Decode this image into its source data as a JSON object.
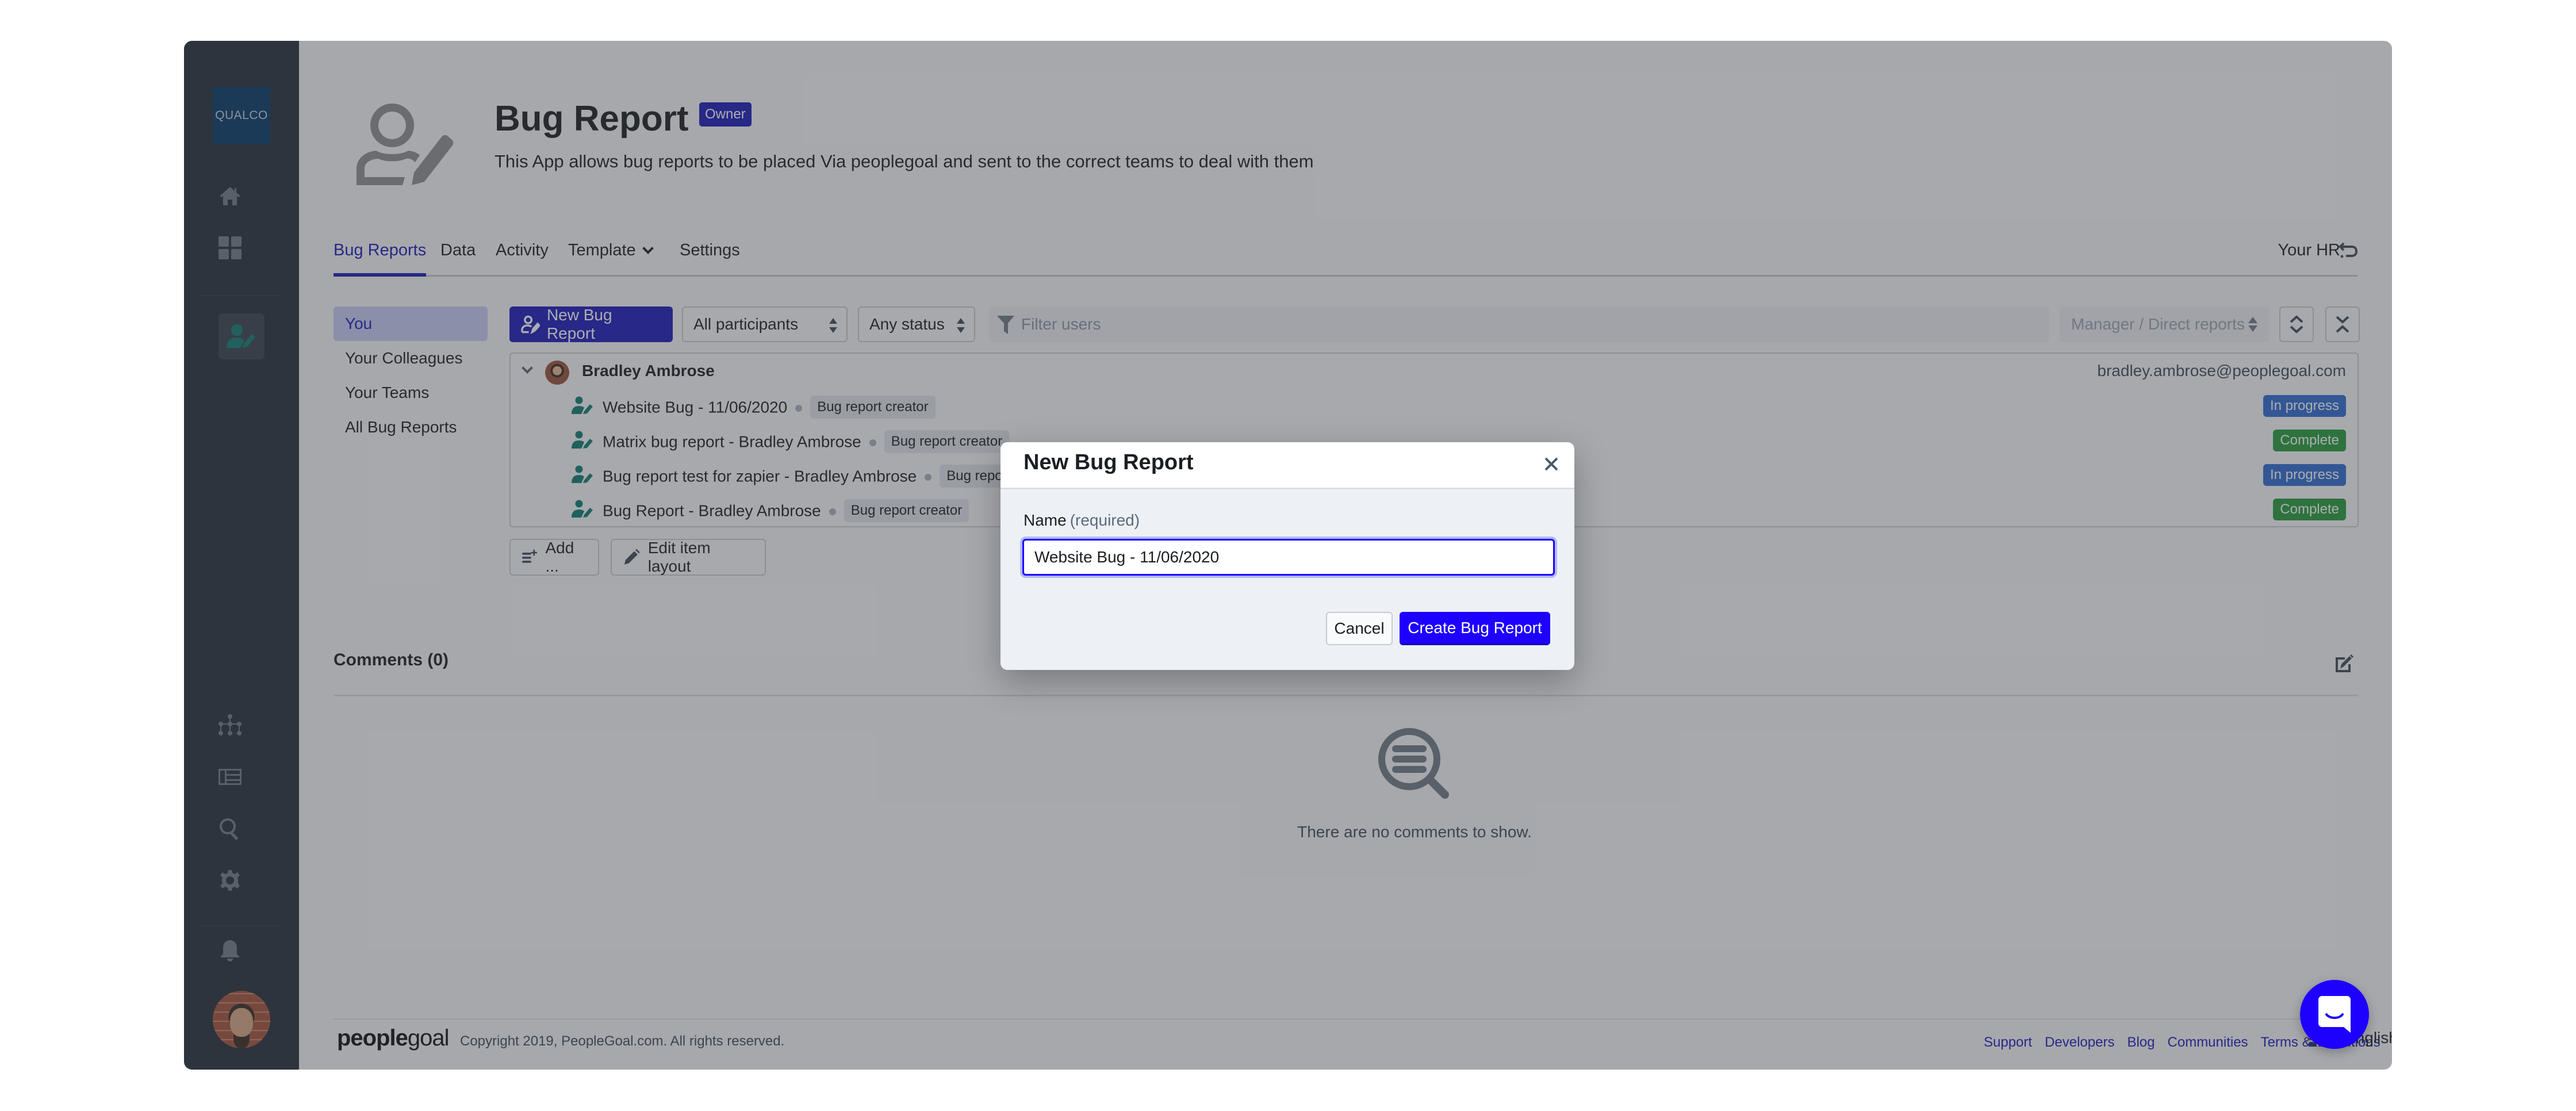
{
  "sidebar": {
    "logo_text": "QUALCO",
    "icons": [
      "home-icon",
      "apps-grid-icon",
      "bug-report-app-icon",
      "org-chart-icon",
      "table-icon",
      "search-icon",
      "settings-icon",
      "notifications-icon",
      "user-avatar"
    ]
  },
  "header": {
    "title": "Bug Report",
    "badge": "Owner",
    "subtitle": "This App allows bug reports to be placed Via peoplegoal and sent to the correct teams to deal with them"
  },
  "tabs": [
    {
      "label": "Bug Reports",
      "active": true
    },
    {
      "label": "Data",
      "active": false
    },
    {
      "label": "Activity",
      "active": false
    },
    {
      "label": "Template",
      "active": false,
      "has_dropdown": true
    },
    {
      "label": "Settings",
      "active": false
    }
  ],
  "your_hr": {
    "label": "Your HR"
  },
  "left_nav": [
    {
      "label": "You",
      "active": true
    },
    {
      "label": "Your Colleagues",
      "active": false
    },
    {
      "label": "Your Teams",
      "active": false
    },
    {
      "label": "All Bug Reports",
      "active": false
    }
  ],
  "toolbar": {
    "new_button": "New Bug Report",
    "participants_select": "All participants",
    "status_select": "Any status",
    "filter_placeholder": "Filter users",
    "manager_select": "Manager / Direct reports"
  },
  "group": {
    "name": "Bradley Ambrose",
    "email": "bradley.ambrose@peoplegoal.com",
    "items": [
      {
        "title": "Website Bug - 11/06/2020",
        "role": "Bug report creator",
        "status": "In progress"
      },
      {
        "title": "Matrix bug report - Bradley Ambrose",
        "role": "Bug report creator",
        "status": "Complete"
      },
      {
        "title": "Bug report test for zapier - Bradley Ambrose",
        "role": "Bug report creator",
        "status": "In progress"
      },
      {
        "title": "Bug Report - Bradley Ambrose",
        "role": "Bug report creator",
        "status": "Complete"
      }
    ]
  },
  "actions": {
    "add": "Add ...",
    "edit_layout": "Edit item layout"
  },
  "comments": {
    "title": "Comments (0)",
    "empty_text": "There are no comments to show."
  },
  "footer": {
    "logo_bold": "people",
    "logo_light": "goal",
    "copyright": "Copyright 2019, PeopleGoal.com. All rights reserved.",
    "links": [
      "Support",
      "Developers",
      "Blog",
      "Communities",
      "Terms & Conditions"
    ],
    "language": "English"
  },
  "modal": {
    "title": "New Bug Report",
    "field_label": "Name",
    "field_hint": "(required)",
    "field_value": "Website Bug - 11/06/2020",
    "cancel": "Cancel",
    "submit": "Create Bug Report"
  },
  "colors": {
    "brand_primary": "#1a1ab8",
    "modal_primary": "#1e00ff",
    "sidebar_bg": "#252f3a",
    "status_in_progress": "#2f6bd1",
    "status_complete": "#279c3b",
    "app_accent": "#0f7d72"
  }
}
